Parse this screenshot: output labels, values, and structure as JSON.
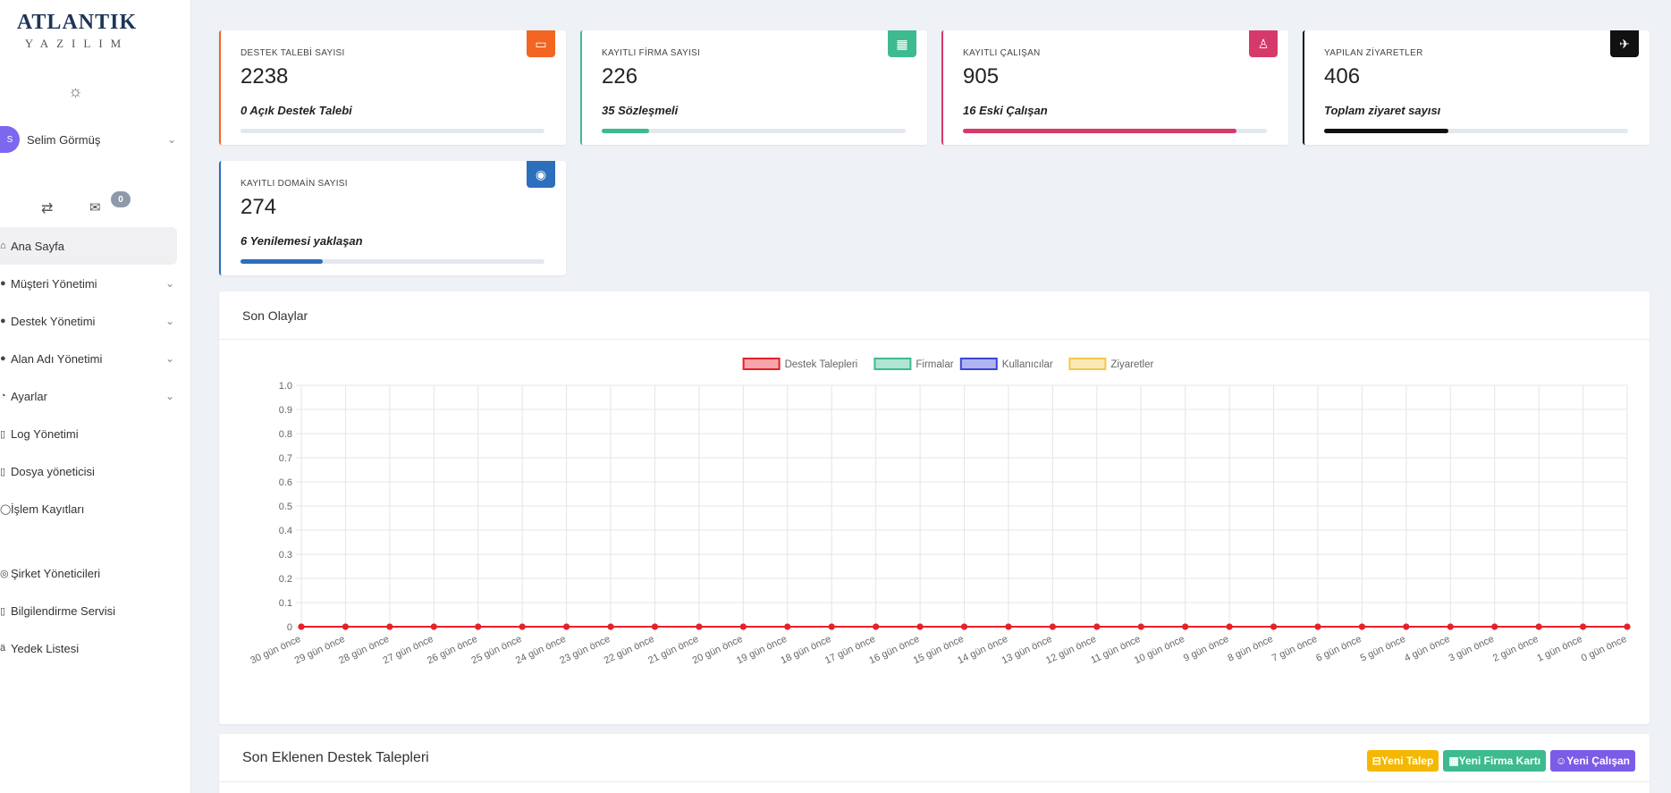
{
  "logo": {
    "main": "ATLANTIK",
    "sub": "YAZILIM"
  },
  "user": {
    "initial": "S",
    "name": "Selim Görmüş"
  },
  "messages": {
    "count": "0"
  },
  "nav": {
    "items": [
      {
        "label": "Ana Sayfa",
        "icon": "home-icon",
        "active": true,
        "has_children": false
      },
      {
        "label": "Müşteri Yönetimi",
        "icon": "customers-icon",
        "has_children": true
      },
      {
        "label": "Destek Yönetimi",
        "icon": "support-icon",
        "has_children": true
      },
      {
        "label": "Alan Adı Yönetimi",
        "icon": "globe-icon",
        "has_children": true
      },
      {
        "label": "Ayarlar",
        "icon": "settings-icon",
        "has_children": true
      },
      {
        "label": "Log Yönetimi",
        "icon": "log-icon",
        "has_children": false
      },
      {
        "label": "Dosya yöneticisi",
        "icon": "file-icon",
        "has_children": false
      },
      {
        "label": "İşlem Kayıtları",
        "icon": "history-icon",
        "has_children": false
      }
    ],
    "items2": [
      {
        "label": "Şirket Yöneticileri",
        "icon": "managers-icon"
      },
      {
        "label": "Bilgilendirme Servisi",
        "icon": "notification-icon"
      },
      {
        "label": "Yedek Listesi",
        "icon": "backup-icon"
      }
    ]
  },
  "stats": [
    {
      "title": "DESTEK TALEBİ SAYISI",
      "value": "2238",
      "sub": "0 Açık Destek Talebi",
      "color": "#f26522",
      "progress": 0,
      "icon": "ticket-icon"
    },
    {
      "title": "KAYITLI FİRMA SAYISI",
      "value": "226",
      "sub": "35 Sözleşmeli",
      "color": "#3dbb8f",
      "progress": 0.155,
      "icon": "building-icon"
    },
    {
      "title": "KAYITLI ÇALIŞAN",
      "value": "905",
      "sub": "16 Eski Çalışan",
      "color": "#d63a6a",
      "progress": 0.9,
      "icon": "user-icon"
    },
    {
      "title": "YAPILAN ZİYARETLER",
      "value": "406",
      "sub": "Toplam ziyaret sayısı",
      "color": "#111111",
      "progress": 0.41,
      "icon": "plane-icon"
    },
    {
      "title": "KAYITLI DOMAİN SAYISI",
      "value": "274",
      "sub": "6 Yenilemesi yaklaşan",
      "color": "#2c6fbd",
      "progress": 0.27,
      "icon": "globe-icon"
    }
  ],
  "events": {
    "title": "Son Olaylar"
  },
  "chart_data": {
    "type": "line",
    "categories": [
      "30 gün önce",
      "29 gün önce",
      "28 gün önce",
      "27 gün önce",
      "26 gün önce",
      "25 gün önce",
      "24 gün önce",
      "23 gün önce",
      "22 gün önce",
      "21 gün önce",
      "20 gün önce",
      "19 gün önce",
      "18 gün önce",
      "17 gün önce",
      "16 gün önce",
      "15 gün önce",
      "14 gün önce",
      "13 gün önce",
      "12 gün önce",
      "11 gün önce",
      "10 gün önce",
      "9 gün önce",
      "8 gün önce",
      "7 gün önce",
      "6 gün önce",
      "5 gün önce",
      "4 gün önce",
      "3 gün önce",
      "2 gün önce",
      "1 gün önce",
      "0 gün önce"
    ],
    "series": [
      {
        "name": "Destek Talepleri",
        "color": "#e8202a",
        "values": [
          0,
          0,
          0,
          0,
          0,
          0,
          0,
          0,
          0,
          0,
          0,
          0,
          0,
          0,
          0,
          0,
          0,
          0,
          0,
          0,
          0,
          0,
          0,
          0,
          0,
          0,
          0,
          0,
          0,
          0,
          0
        ]
      },
      {
        "name": "Firmalar",
        "color": "#3dbb8f",
        "values": [
          0,
          0,
          0,
          0,
          0,
          0,
          0,
          0,
          0,
          0,
          0,
          0,
          0,
          0,
          0,
          0,
          0,
          0,
          0,
          0,
          0,
          0,
          0,
          0,
          0,
          0,
          0,
          0,
          0,
          0,
          0
        ]
      },
      {
        "name": "Kullanıcılar",
        "color": "#3b46d6",
        "values": [
          0,
          0,
          0,
          0,
          0,
          0,
          0,
          0,
          0,
          0,
          0,
          0,
          0,
          0,
          0,
          0,
          0,
          0,
          0,
          0,
          0,
          0,
          0,
          0,
          0,
          0,
          0,
          0,
          0,
          0,
          0
        ]
      },
      {
        "name": "Ziyaretler",
        "color": "#f2c84b",
        "values": [
          0,
          0,
          0,
          0,
          0,
          0,
          0,
          0,
          0,
          0,
          0,
          0,
          0,
          0,
          0,
          0,
          0,
          0,
          0,
          0,
          0,
          0,
          0,
          0,
          0,
          0,
          0,
          0,
          0,
          0,
          0
        ]
      }
    ],
    "ylim": [
      0,
      1.0
    ],
    "yticks": [
      "0",
      "0.1",
      "0.2",
      "0.3",
      "0.4",
      "0.5",
      "0.6",
      "0.7",
      "0.8",
      "0.9",
      "1.0"
    ],
    "grid": true,
    "legend": "top-center"
  },
  "tickets": {
    "title": "Son Eklenen Destek Talepleri",
    "buttons": [
      {
        "label": "Yeni Talep",
        "color": "#f5b800"
      },
      {
        "label": "Yeni Firma Kartı",
        "color": "#3dbb8f"
      },
      {
        "label": "Yeni Çalışan",
        "color": "#7b5ce6"
      }
    ]
  }
}
